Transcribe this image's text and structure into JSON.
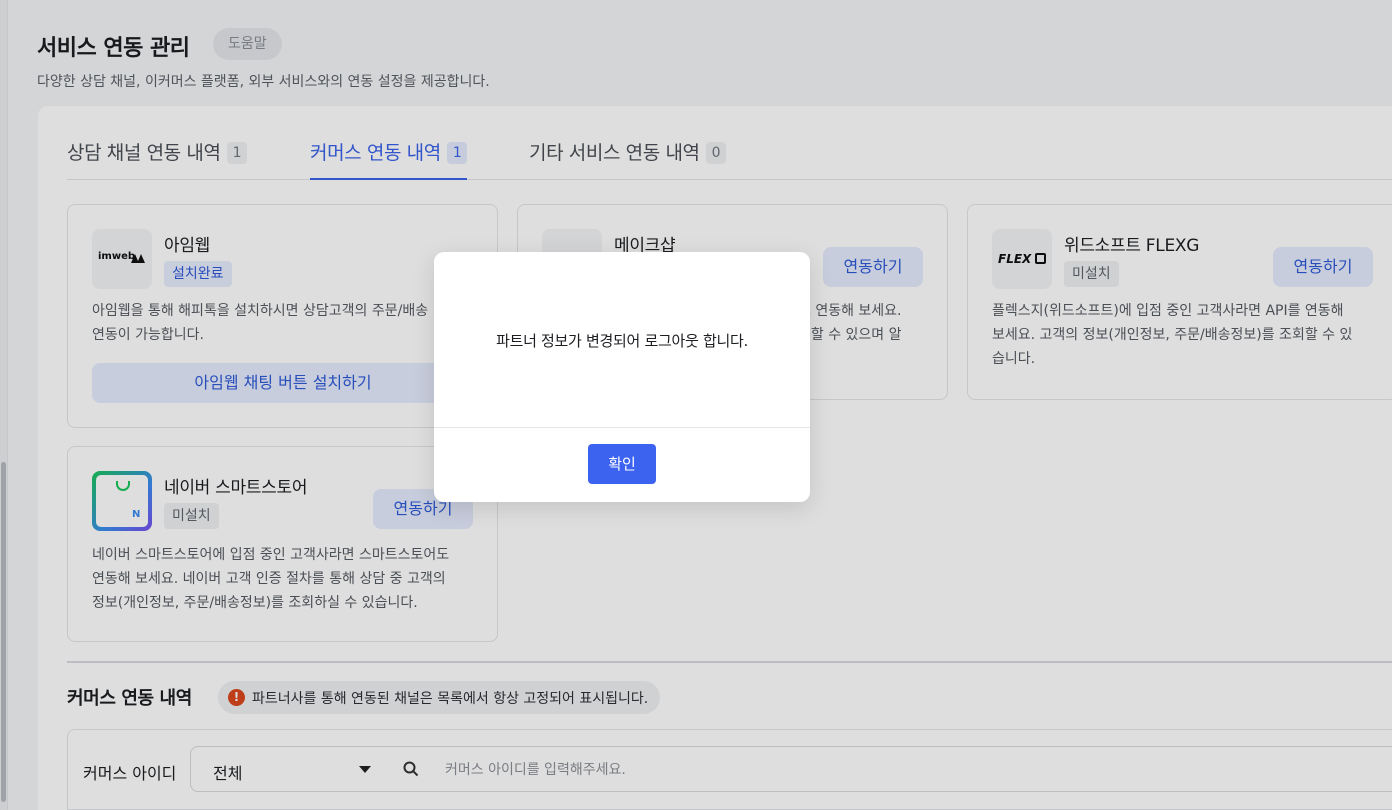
{
  "header": {
    "title": "서비스 연동 관리",
    "help_label": "도움말",
    "description": "다양한 상담 채널, 이커머스 플랫폼, 외부 서비스와의 연동 설정을 제공합니다."
  },
  "tabs": [
    {
      "label": "상담 채널 연동 내역",
      "count": "1",
      "active": false
    },
    {
      "label": "커머스 연동 내역",
      "count": "1",
      "active": true
    },
    {
      "label": "기타 서비스 연동 내역",
      "count": "0",
      "active": false
    }
  ],
  "cards": [
    {
      "name": "아임웹",
      "logo_text": "imweb",
      "status": "설치완료",
      "description_lines": [
        "아임웹을 통해 해피톡을 설치하시면 상담고객의 주문/배송",
        "연동이 가능합니다."
      ],
      "wide_button": "아임웹 채팅 버튼 설치하기"
    },
    {
      "name": "메이크샵",
      "button": "연동하기",
      "description_lines": [
        "도 연동해 보세요.",
        "회할 수 있으며 알"
      ]
    },
    {
      "name": "위드소프트 FLEXG",
      "logo_text": "FLEX",
      "status": "미설치",
      "button": "연동하기",
      "description_lines": [
        "플렉스지(위드소프트)에 입점 중인 고객사라면 API를 연동해",
        "보세요. 고객의 정보(개인정보, 주문/배송정보)를 조회할 수 있",
        "습니다."
      ]
    },
    {
      "name": "네이버 스마트스토어",
      "logo_text": "N",
      "status": "미설치",
      "button": "연동하기",
      "description_lines": [
        "네이버 스마트스토어에 입점 중인 고객사라면 스마트스토어도",
        "연동해 보세요. 네이버 고객 인증 절차를 통해 상담 중 고객의",
        "정보(개인정보, 주문/배송정보)를 조회하실 수 있습니다."
      ]
    }
  ],
  "section": {
    "title": "커머스 연동 내역",
    "info": "파트너사를 통해 연동된 채널은 목록에서 항상 고정되어 표시됩니다."
  },
  "filter": {
    "label": "커머스 아이디",
    "select_value": "전체",
    "search_placeholder": "커머스 아이디를 입력해주세요."
  },
  "modal": {
    "message": "파트너 정보가 변경되어 로그아웃 합니다.",
    "confirm_label": "확인"
  },
  "colors": {
    "accent": "#3b63f0",
    "tab_active": "#3b63e8",
    "info_icon": "#d9481c"
  },
  "icons": {
    "info": "info-circle-icon",
    "search": "search-icon",
    "dropdown": "caret-down-icon"
  }
}
